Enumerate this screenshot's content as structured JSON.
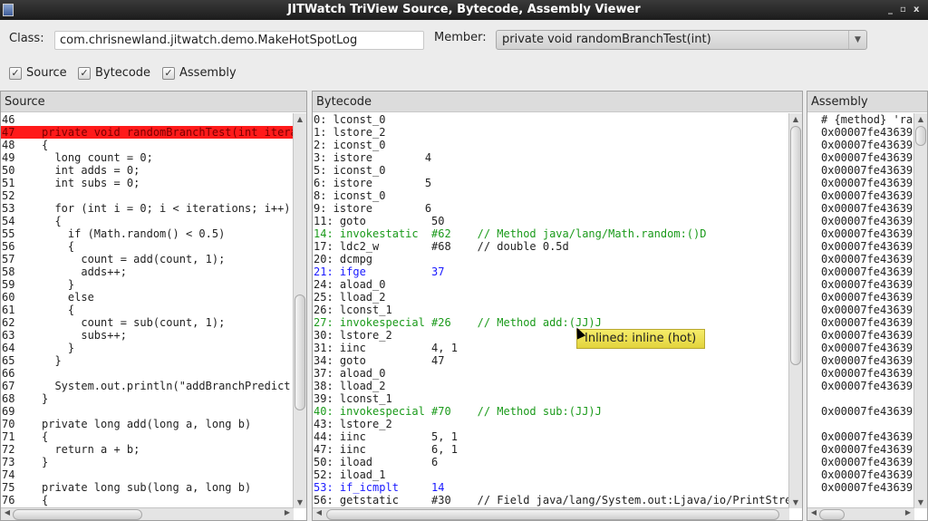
{
  "window": {
    "title": "JITWatch TriView Source, Bytecode, Assembly Viewer",
    "controls": [
      "_",
      "▫",
      "x"
    ]
  },
  "toolbar": {
    "class_label": "Class:",
    "class_value": "com.chrisnewland.jitwatch.demo.MakeHotSpotLog",
    "member_label": "Member:",
    "member_value": "private void randomBranchTest(int)"
  },
  "checkboxes": [
    {
      "label": "Source",
      "checked": true
    },
    {
      "label": "Bytecode",
      "checked": true
    },
    {
      "label": "Assembly",
      "checked": true
    }
  ],
  "source": {
    "title": "Source",
    "highlight_line": "47",
    "lines": [
      [
        "46",
        ""
      ],
      [
        "47",
        "private void randomBranchTest(int itera"
      ],
      [
        "48",
        "{"
      ],
      [
        "49",
        "  long count = 0;"
      ],
      [
        "50",
        "  int adds = 0;"
      ],
      [
        "51",
        "  int subs = 0;"
      ],
      [
        "52",
        ""
      ],
      [
        "53",
        "  for (int i = 0; i < iterations; i++)"
      ],
      [
        "54",
        "  {"
      ],
      [
        "55",
        "    if (Math.random() < 0.5)"
      ],
      [
        "56",
        "    {"
      ],
      [
        "57",
        "      count = add(count, 1);"
      ],
      [
        "58",
        "      adds++;"
      ],
      [
        "59",
        "    }"
      ],
      [
        "60",
        "    else"
      ],
      [
        "61",
        "    {"
      ],
      [
        "62",
        "      count = sub(count, 1);"
      ],
      [
        "63",
        "      subs++;"
      ],
      [
        "64",
        "    }"
      ],
      [
        "65",
        "  }"
      ],
      [
        "66",
        ""
      ],
      [
        "67",
        "  System.out.println(\"addBranchPredict"
      ],
      [
        "68",
        "}"
      ],
      [
        "69",
        ""
      ],
      [
        "70",
        "private long add(long a, long b)"
      ],
      [
        "71",
        "{"
      ],
      [
        "72",
        "  return a + b;"
      ],
      [
        "73",
        "}"
      ],
      [
        "74",
        ""
      ],
      [
        "75",
        "private long sub(long a, long b)"
      ],
      [
        "76",
        "{"
      ]
    ]
  },
  "bytecode": {
    "title": "Bytecode",
    "lines": [
      {
        "t": "0: lconst_0",
        "k": ""
      },
      {
        "t": "1: lstore_2",
        "k": ""
      },
      {
        "t": "2: iconst_0",
        "k": ""
      },
      {
        "t": "3: istore        4",
        "k": ""
      },
      {
        "t": "5: iconst_0",
        "k": ""
      },
      {
        "t": "6: istore        5",
        "k": ""
      },
      {
        "t": "8: iconst_0",
        "k": ""
      },
      {
        "t": "9: istore        6",
        "k": ""
      },
      {
        "t": "11: goto          50",
        "k": ""
      },
      {
        "t": "14: invokestatic  #62    // Method java/lang/Math.random:()D",
        "k": "green"
      },
      {
        "t": "17: ldc2_w        #68    // double 0.5d",
        "k": ""
      },
      {
        "t": "20: dcmpg",
        "k": ""
      },
      {
        "t": "21: ifge          37",
        "k": "blue"
      },
      {
        "t": "24: aload_0",
        "k": ""
      },
      {
        "t": "25: lload_2",
        "k": ""
      },
      {
        "t": "26: lconst_1",
        "k": ""
      },
      {
        "t": "27: invokespecial #26    // Method add:(JJ)J",
        "k": "green"
      },
      {
        "t": "30: lstore_2",
        "k": ""
      },
      {
        "t": "31: iinc          4, 1",
        "k": ""
      },
      {
        "t": "34: goto          47",
        "k": ""
      },
      {
        "t": "37: aload_0",
        "k": ""
      },
      {
        "t": "38: lload_2",
        "k": ""
      },
      {
        "t": "39: lconst_1",
        "k": ""
      },
      {
        "t": "40: invokespecial #70    // Method sub:(JJ)J",
        "k": "green"
      },
      {
        "t": "43: lstore_2",
        "k": ""
      },
      {
        "t": "44: iinc          5, 1",
        "k": ""
      },
      {
        "t": "47: iinc          6, 1",
        "k": ""
      },
      {
        "t": "50: iload         6",
        "k": ""
      },
      {
        "t": "52: iload_1",
        "k": ""
      },
      {
        "t": "53: if_icmplt     14",
        "k": "blue"
      },
      {
        "t": "56: getstatic     #30    // Field java/lang/System.out:Ljava/io/PrintStre",
        "k": ""
      }
    ]
  },
  "assembly": {
    "title": "Assembly",
    "lines": [
      "# {method} 'ra",
      "0x00007fe43639",
      "0x00007fe43639",
      "0x00007fe43639",
      "0x00007fe43639",
      "0x00007fe43639",
      "0x00007fe43639",
      "0x00007fe43639",
      "0x00007fe43639",
      "0x00007fe43639",
      "0x00007fe43639",
      "0x00007fe43639",
      "0x00007fe43639",
      "0x00007fe43639",
      "0x00007fe43639",
      "0x00007fe43639",
      "0x00007fe43639",
      "0x00007fe43639",
      "0x00007fe43639",
      "0x00007fe43639",
      "0x00007fe43639",
      "0x00007fe43639",
      "",
      "0x00007fe43639",
      "",
      "0x00007fe43639",
      "0x00007fe43639",
      "0x00007fe43639",
      "0x00007fe43639",
      "0x00007fe43639"
    ]
  },
  "tooltip": {
    "text": "Inlined: inline (hot)"
  },
  "colors": {
    "highlight": "#ff1a1a",
    "invoke": "#1a9a1a",
    "branch": "#1a1aff",
    "tooltip": "#f0e35a"
  }
}
